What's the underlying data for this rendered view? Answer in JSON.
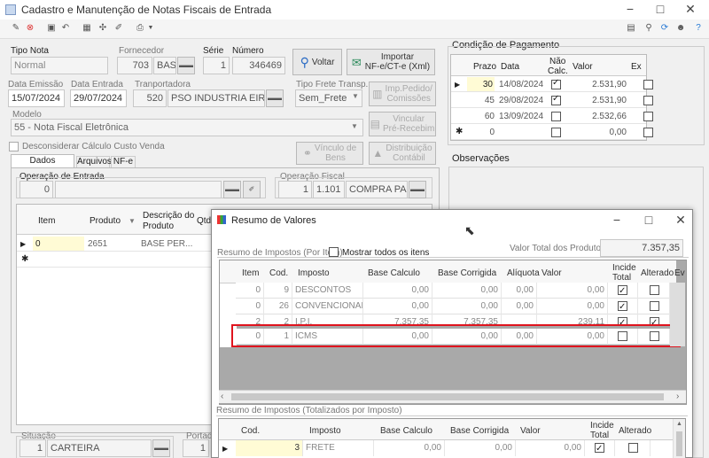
{
  "window": {
    "title": "Cadastro e Manutenção de Notas Fiscais de Entrada"
  },
  "header": {
    "tipo_nota_label": "Tipo Nota",
    "tipo_nota": "Normal",
    "fornecedor_label": "Fornecedor",
    "fornecedor_code": "703",
    "fornecedor_name": "BAS",
    "serie_label": "Série",
    "serie": "1",
    "numero_label": "Número",
    "numero": "346469",
    "voltar_label": "Voltar",
    "importar_label1": "Importar",
    "importar_label2": "NF-e/CT-e (Xml)",
    "data_emissao_label": "Data Emissão",
    "data_emissao": "15/07/2024",
    "data_entrada_label": "Data Entrada",
    "data_entrada": "29/07/2024",
    "transportadora_label": "Tranportadora",
    "transportadora_code": "520",
    "transportadora_name": "PSO INDUSTRIA EIRE",
    "tipo_frete_label": "Tipo Frete Transp.",
    "tipo_frete": "Sem_Frete",
    "imp_pedido_label1": "Imp.Pedido/",
    "imp_pedido_label2": "Comissões",
    "modelo_label": "Modelo",
    "modelo": "55 - Nota Fiscal Eletrônica",
    "vincular_label1": "Vincular",
    "vincular_label2": "Pré-Recebim",
    "desconsiderar_label": "Desconsiderar Cálculo Custo Venda",
    "vinculo_bens_label1": "Vínculo de",
    "vinculo_bens_label2": "Bens",
    "distribuicao_label1": "Distribuição",
    "distribuicao_label2": "Contábil"
  },
  "tabs": [
    {
      "label": "Dados Principais"
    },
    {
      "label": "Arquivos"
    },
    {
      "label": "NF-e"
    }
  ],
  "main": {
    "op_entrada_label": "Operação de Entrada",
    "op_entrada": "0",
    "op_fiscal_label": "Operação Fiscal",
    "op_fiscal_code": "1",
    "op_fiscal_cfop": "1.101",
    "op_fiscal_name": "COMPRA PAF",
    "items_headers": {
      "item": "Item",
      "produto": "Produto",
      "descricao1": "Descrição do",
      "descricao2": "Produto",
      "qtd": "Qtd"
    },
    "items_rows": [
      {
        "item": "0",
        "produto": "2651",
        "descricao": "BASE PER..."
      }
    ],
    "situacao_label": "Situação",
    "situacao_code": "1",
    "situacao": "CARTEIRA",
    "portador_label": "Portad",
    "portador_code": "1"
  },
  "pagamento": {
    "title": "Condição de Pagamento",
    "headers": {
      "prazo": "Prazo",
      "data": "Data",
      "nao_calc1": "Não",
      "nao_calc2": "Calc.",
      "valor": "Valor",
      "ex": "Ex"
    },
    "rows": [
      {
        "prazo": "30",
        "data": "14/08/2024",
        "nao_calc": true,
        "valor": "2.531,90",
        "ex": false
      },
      {
        "prazo": "45",
        "data": "29/08/2024",
        "nao_calc": true,
        "valor": "2.531,90",
        "ex": false
      },
      {
        "prazo": "60",
        "data": "13/09/2024",
        "nao_calc": false,
        "valor": "2.532,66",
        "ex": false
      },
      {
        "prazo": "0",
        "data": "",
        "nao_calc": false,
        "valor": "0,00",
        "ex": false
      }
    ]
  },
  "observacoes": {
    "title": "Observações"
  },
  "modal": {
    "title": "Resumo de Valores",
    "section1_label": "Resumo de Impostos (Por Item)",
    "mostrar_label": "Mostrar todos os itens",
    "valor_total_label": "Valor Total dos Produtos",
    "valor_total": "7.357,35",
    "headers": {
      "item": "Item",
      "cod": "Cod.",
      "imposto": "Imposto",
      "base_calculo": "Base Calculo",
      "base_corrigida": "Base Corrigida",
      "aliquota": "Alíquota",
      "valor": "Valor",
      "incide1": "Incide",
      "incide2": "Total",
      "alterado": "Alterado",
      "ev": "Ev"
    },
    "rows": [
      {
        "item": "0",
        "cod": "9",
        "imposto": "DESCONTOS",
        "base_calculo": "0,00",
        "base_corrigida": "0,00",
        "aliquota": "0,00",
        "valor": "0,00",
        "incide": true,
        "alterado": false
      },
      {
        "item": "0",
        "cod": "26",
        "imposto": "CONVENCIONAL",
        "base_calculo": "0,00",
        "base_corrigida": "0,00",
        "aliquota": "0,00",
        "valor": "0,00",
        "incide": true,
        "alterado": false
      },
      {
        "item": "2",
        "cod": "2",
        "imposto": "I.P.I.",
        "base_calculo": "7.357,35",
        "base_corrigida": "7.357,35",
        "aliquota": "",
        "valor": "239,11",
        "incide": true,
        "alterado": true
      },
      {
        "item": "0",
        "cod": "1",
        "imposto": "ICMS",
        "base_calculo": "0,00",
        "base_corrigida": "0,00",
        "aliquota": "0,00",
        "valor": "0,00",
        "incide": false,
        "alterado": false
      }
    ],
    "section2_label": "Resumo de Impostos (Totalizados por Imposto)",
    "headers2": {
      "cod": "Cod.",
      "imposto": "Imposto",
      "base_calculo": "Base Calculo",
      "base_corrigida": "Base Corrigida",
      "valor": "Valor",
      "incide1": "Incide",
      "incide2": "Total",
      "alterado": "Alterado"
    },
    "rows2": [
      {
        "cod": "3",
        "imposto": "FRETE",
        "base_calculo": "0,00",
        "base_corrigida": "0,00",
        "valor": "0,00",
        "incide": true,
        "alterado": false
      }
    ]
  },
  "colors": {
    "highlight": "#e0141e",
    "yellow": "#fffbd5"
  }
}
